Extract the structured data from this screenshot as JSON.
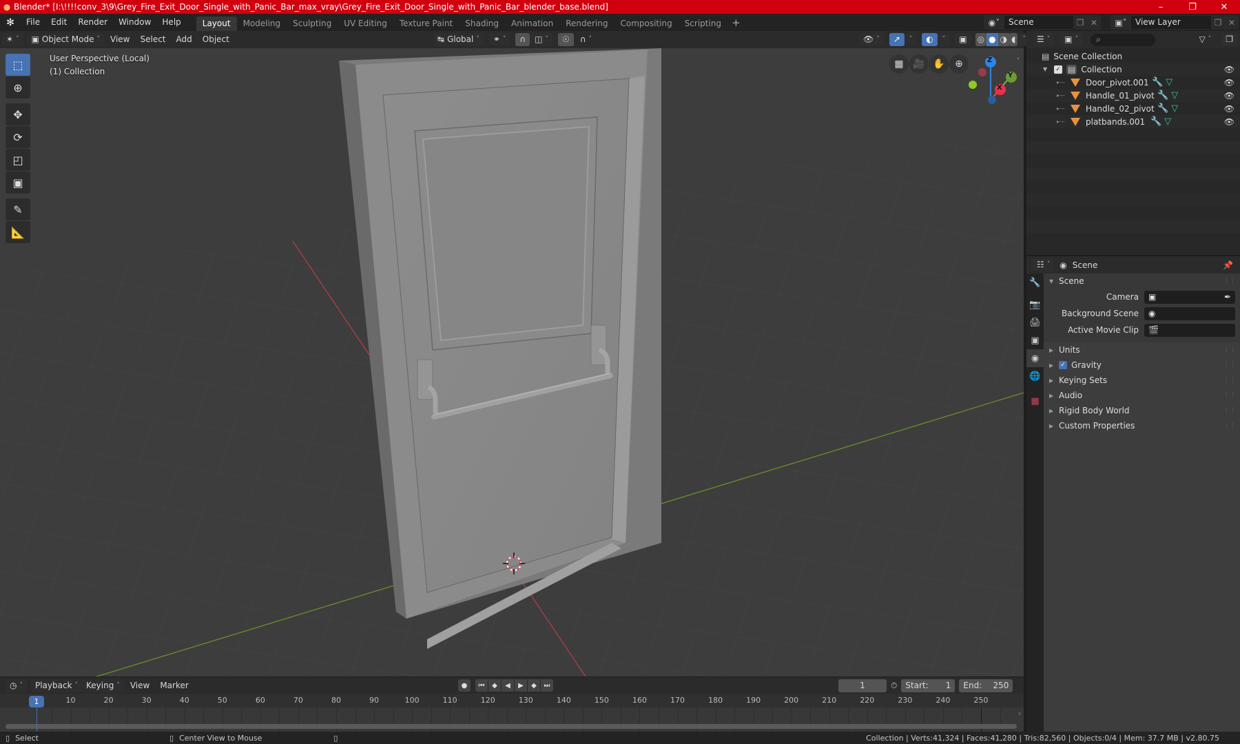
{
  "window": {
    "title": "Blender* [I:\\!!!!conv_3\\9\\Grey_Fire_Exit_Door_Single_with_Panic_Bar_max_vray\\Grey_Fire_Exit_Door_Single_with_Panic_Bar_blender_base.blend]",
    "controls": {
      "minimize": "–",
      "maximize": "❐",
      "close": "✕"
    }
  },
  "menu": {
    "items": [
      "File",
      "Edit",
      "Render",
      "Window",
      "Help"
    ],
    "workspaces": [
      "Layout",
      "Modeling",
      "Sculpting",
      "UV Editing",
      "Texture Paint",
      "Shading",
      "Animation",
      "Rendering",
      "Compositing",
      "Scripting"
    ],
    "active_workspace": "Layout",
    "add_tab": "+"
  },
  "scene_selector": {
    "value": "Scene"
  },
  "view_layer_selector": {
    "value": "View Layer"
  },
  "viewport_header": {
    "mode": "Object Mode",
    "menus": [
      "View",
      "Select",
      "Add",
      "Object"
    ],
    "orientation": "Global"
  },
  "viewport": {
    "perspective_label": "User Perspective (Local)",
    "collection_label": "(1) Collection",
    "gizmo": {
      "z": "Z",
      "y": "Y",
      "x": "X"
    },
    "colors": {
      "x_axis": "#e9314b",
      "y_axis": "#7bb33a",
      "z_axis": "#2f84e3",
      "background": "#3d3d3d",
      "grid": "#474747",
      "door": "#8a8a8a"
    }
  },
  "tools": [
    "select-box",
    "cursor",
    "move",
    "rotate",
    "scale",
    "transform",
    "annotate",
    "measure"
  ],
  "outliner": {
    "search_placeholder": "",
    "root": "Scene Collection",
    "collection": "Collection",
    "objects": [
      {
        "name": "Door_pivot.001"
      },
      {
        "name": "Handle_01_pivot"
      },
      {
        "name": "Handle_02_pivot"
      },
      {
        "name": "platbands.001"
      }
    ]
  },
  "properties": {
    "header": "Scene",
    "panel_title": "Scene",
    "fields": [
      {
        "label": "Camera",
        "value": ""
      },
      {
        "label": "Background Scene",
        "value": ""
      },
      {
        "label": "Active Movie Clip",
        "value": ""
      }
    ],
    "sections": [
      {
        "label": "Units"
      },
      {
        "label": "Gravity",
        "checked": true
      },
      {
        "label": "Keying Sets"
      },
      {
        "label": "Audio"
      },
      {
        "label": "Rigid Body World"
      },
      {
        "label": "Custom Properties"
      }
    ]
  },
  "timeline": {
    "menus": [
      "Playback",
      "Keying",
      "View",
      "Marker"
    ],
    "current_frame": "1",
    "start_label": "Start:",
    "start": "1",
    "end_label": "End:",
    "end": "250",
    "ticks": [
      "10",
      "20",
      "30",
      "40",
      "50",
      "60",
      "70",
      "80",
      "90",
      "100",
      "110",
      "120",
      "130",
      "140",
      "150",
      "160",
      "170",
      "180",
      "190",
      "200",
      "210",
      "220",
      "230",
      "240",
      "250"
    ],
    "playhead": "1"
  },
  "statusbar": {
    "left_action": "Select",
    "middle_action": "Center View to Mouse",
    "stats": "Collection | Verts:41,324 | Faces:41,280 | Tris:82,560 | Objects:0/4 | Mem: 37.7 MB | v2.80.75"
  }
}
